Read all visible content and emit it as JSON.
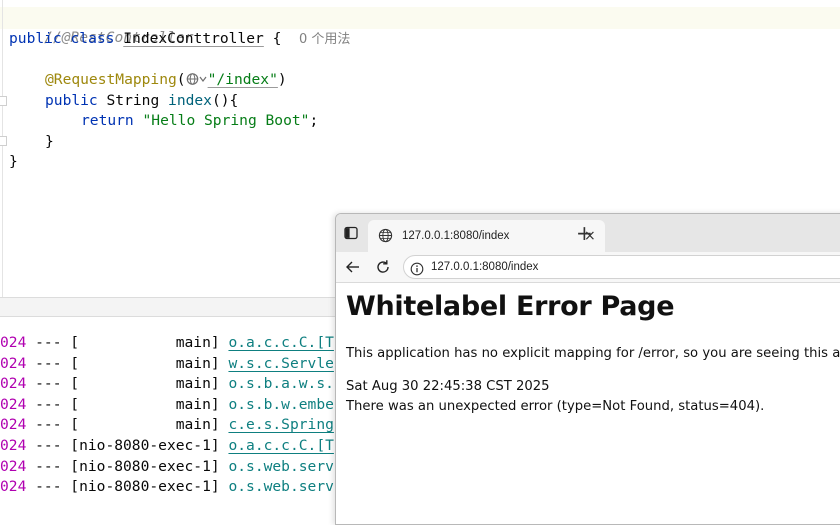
{
  "editor": {
    "line1_comment": "//@RestController",
    "line2_kw1": "public",
    "line2_kw2": "class",
    "line2_classname": "IndexConttroller",
    "line2_brace": " {",
    "line2_usage_hint": "0 个用法",
    "line4_annotation": "@RequestMapping",
    "line4_path": "\"/index\"",
    "line5_kw1": "public",
    "line5_type": "String",
    "line5_method": "index",
    "line5_rest": "(){",
    "line6_kw": "return",
    "line6_string": "\"Hello Spring Boot\"",
    "line6_end": ";",
    "line7": "}",
    "line8": "}"
  },
  "console": {
    "lines": [
      {
        "date": "024",
        "sep": " --- ",
        "thread": "[           main]",
        "logger": "o.a.c.c.C.[T"
      },
      {
        "date": "024",
        "sep": " --- ",
        "thread": "[           main]",
        "logger": "w.s.c.Servle"
      },
      {
        "date": "024",
        "sep": " --- ",
        "thread": "[           main]",
        "logger": "o.s.b.a.w.s."
      },
      {
        "date": "024",
        "sep": " --- ",
        "thread": "[           main]",
        "logger": "o.s.b.w.embe"
      },
      {
        "date": "024",
        "sep": " --- ",
        "thread": "[           main]",
        "logger": "c.e.s.Spring"
      },
      {
        "date": "024",
        "sep": " --- ",
        "thread": "[nio-8080-exec-1]",
        "logger": "o.a.c.c.C.[T"
      },
      {
        "date": "024",
        "sep": " --- ",
        "thread": "[nio-8080-exec-1]",
        "logger": "o.s.web.serv"
      },
      {
        "date": "024",
        "sep": " --- ",
        "thread": "[nio-8080-exec-1]",
        "logger": "o.s.web.serv"
      }
    ]
  },
  "browser": {
    "tab_title": "127.0.0.1:8080/index",
    "tab_close": "×",
    "new_tab": "+",
    "url": "127.0.0.1:8080/index",
    "page_title": "Whitelabel Error Page",
    "message": "This application has no explicit mapping for /error, so you are seeing this as a fallb",
    "date": "Sat Aug 30 22:45:38 CST 2025",
    "error": "There was an unexpected error (type=Not Found, status=404)."
  },
  "icons": {
    "sidebar": "sidebar-toggle-icon",
    "tab_favicon": "globe-icon",
    "back": "back-arrow-icon",
    "reload": "reload-icon",
    "info": "info-icon",
    "web_endpoint": "web-globe-icon"
  }
}
